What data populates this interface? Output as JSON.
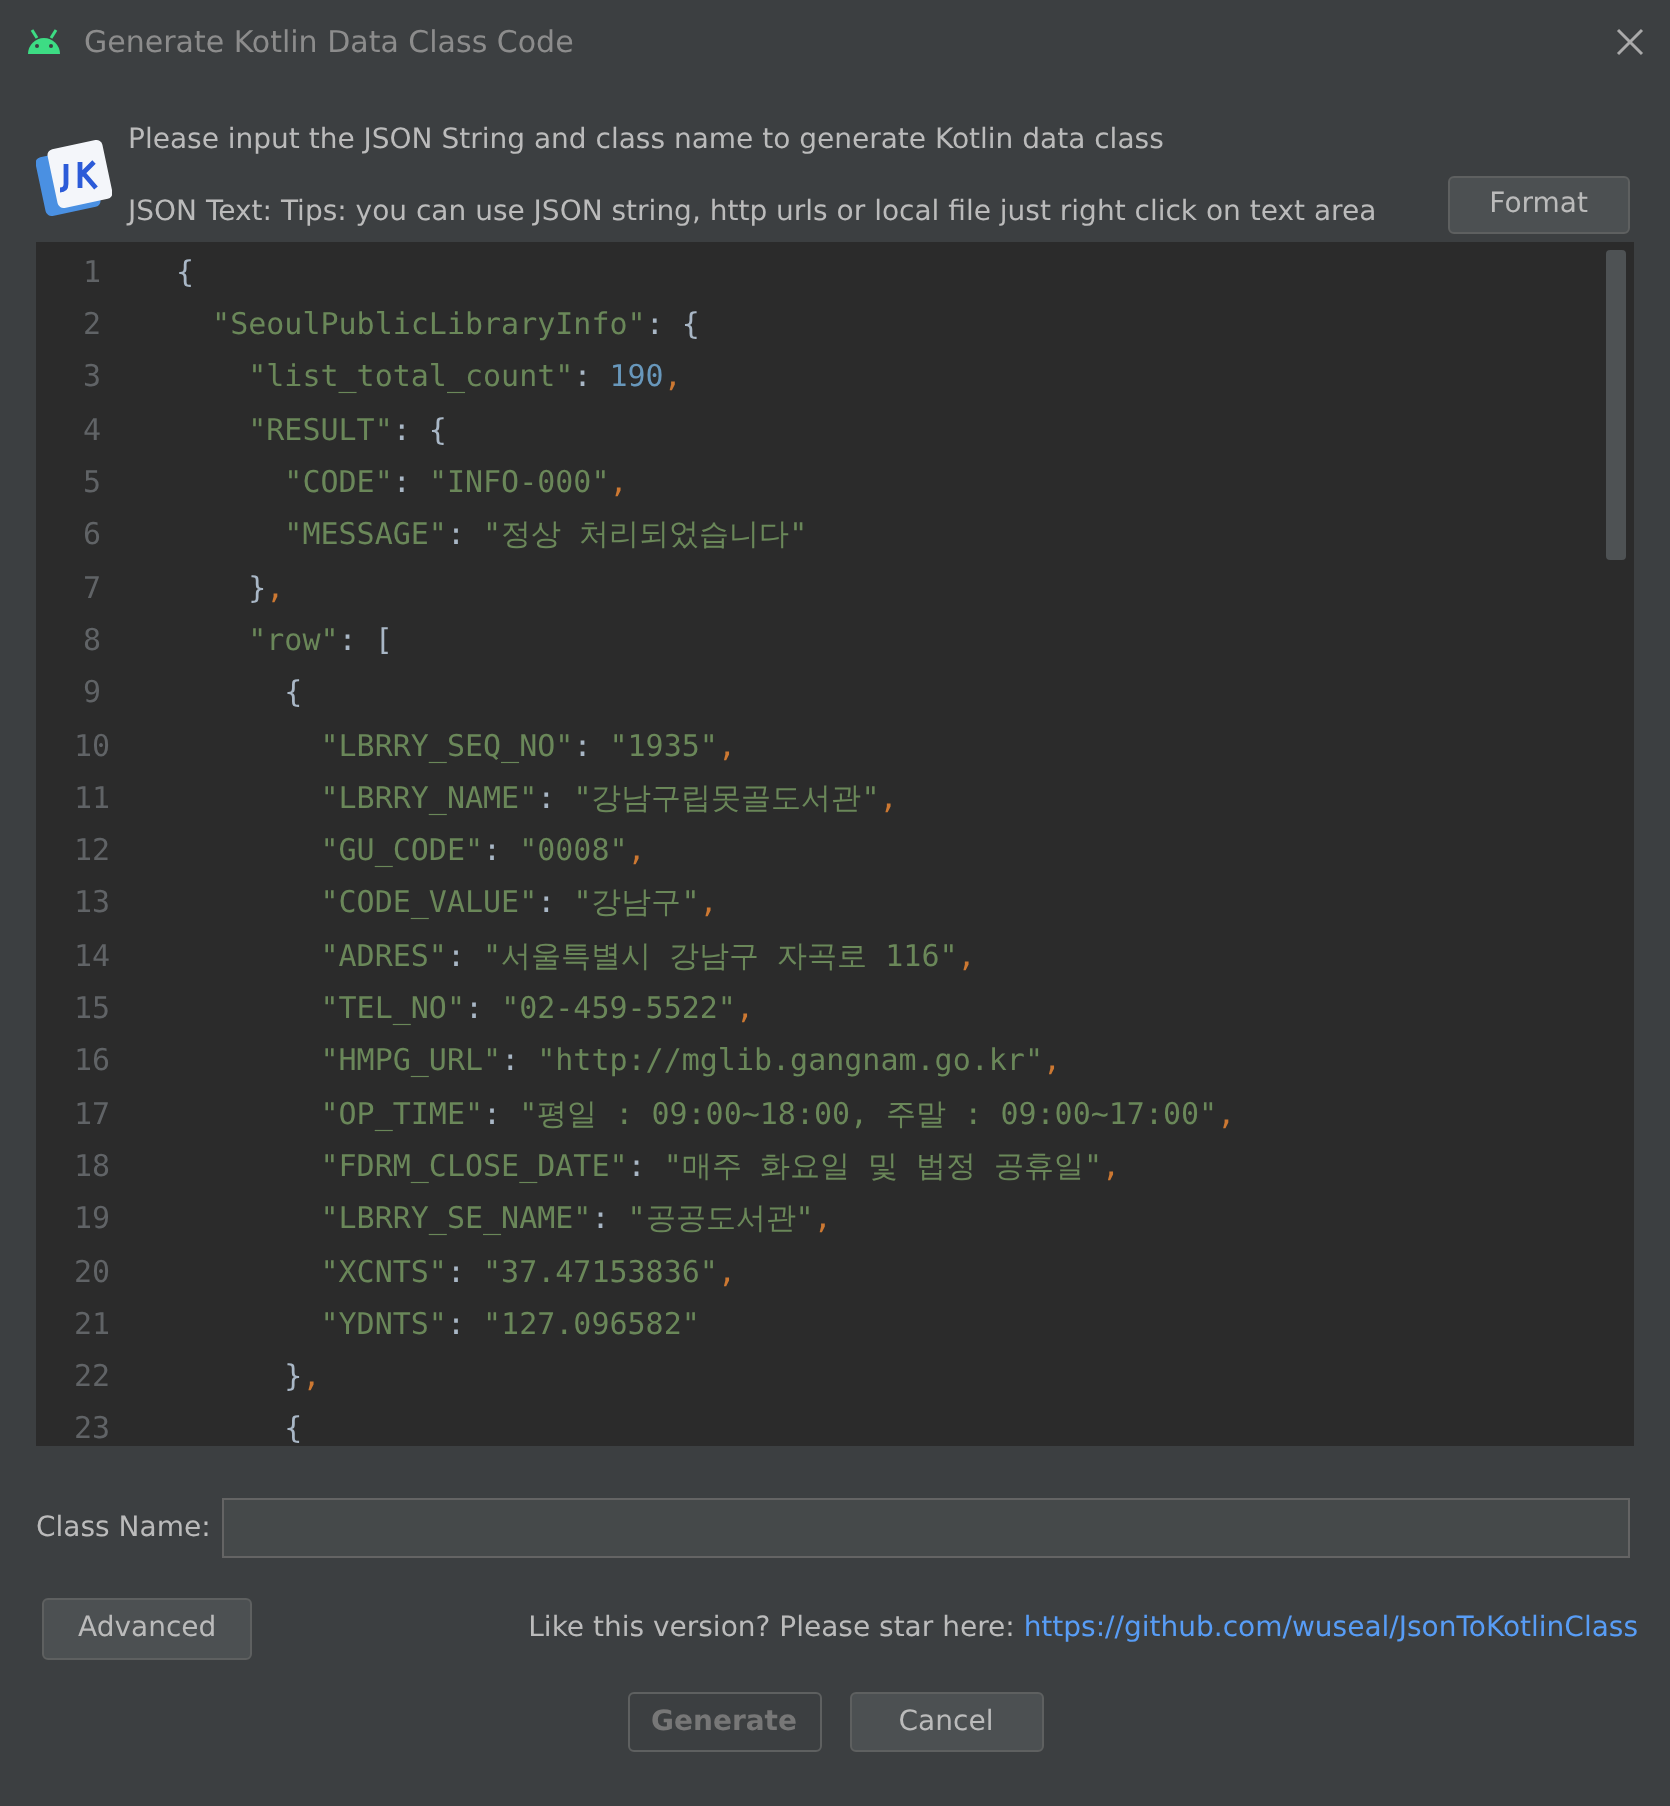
{
  "window": {
    "title": "Generate Kotlin Data Class Code"
  },
  "header": {
    "message": "Please input the JSON String and class name to generate Kotlin data class",
    "tips": "JSON Text: Tips: you can use JSON string, http urls or local file just right click on text area",
    "format_button": "Format"
  },
  "editor": {
    "lines": [
      {
        "number": "1",
        "tokens": [
          {
            "kind": "punct",
            "text": "{"
          }
        ]
      },
      {
        "number": "2",
        "tokens": [
          {
            "kind": "key",
            "text": "  \"SeoulPublicLibraryInfo\""
          },
          {
            "kind": "punct",
            "text": ": {"
          }
        ]
      },
      {
        "number": "3",
        "tokens": [
          {
            "kind": "key",
            "text": "    \"list_total_count\""
          },
          {
            "kind": "punct",
            "text": ": "
          },
          {
            "kind": "number",
            "text": "190"
          },
          {
            "kind": "comma",
            "text": ","
          }
        ]
      },
      {
        "number": "4",
        "tokens": [
          {
            "kind": "key",
            "text": "    \"RESULT\""
          },
          {
            "kind": "punct",
            "text": ": {"
          }
        ]
      },
      {
        "number": "5",
        "tokens": [
          {
            "kind": "key",
            "text": "      \"CODE\""
          },
          {
            "kind": "punct",
            "text": ": "
          },
          {
            "kind": "string",
            "text": "\"INFO-000\""
          },
          {
            "kind": "comma",
            "text": ","
          }
        ]
      },
      {
        "number": "6",
        "tokens": [
          {
            "kind": "key",
            "text": "      \"MESSAGE\""
          },
          {
            "kind": "punct",
            "text": ": "
          },
          {
            "kind": "string",
            "text": "\"정상 처리되었습니다\""
          }
        ]
      },
      {
        "number": "7",
        "tokens": [
          {
            "kind": "punct",
            "text": "    }"
          },
          {
            "kind": "comma",
            "text": ","
          }
        ]
      },
      {
        "number": "8",
        "tokens": [
          {
            "kind": "key",
            "text": "    \"row\""
          },
          {
            "kind": "punct",
            "text": ": ["
          }
        ]
      },
      {
        "number": "9",
        "tokens": [
          {
            "kind": "punct",
            "text": "      {"
          }
        ]
      },
      {
        "number": "10",
        "tokens": [
          {
            "kind": "key",
            "text": "        \"LBRRY_SEQ_NO\""
          },
          {
            "kind": "punct",
            "text": ": "
          },
          {
            "kind": "string",
            "text": "\"1935\""
          },
          {
            "kind": "comma",
            "text": ","
          }
        ]
      },
      {
        "number": "11",
        "tokens": [
          {
            "kind": "key",
            "text": "        \"LBRRY_NAME\""
          },
          {
            "kind": "punct",
            "text": ": "
          },
          {
            "kind": "string",
            "text": "\"강남구립못골도서관\""
          },
          {
            "kind": "comma",
            "text": ","
          }
        ]
      },
      {
        "number": "12",
        "tokens": [
          {
            "kind": "key",
            "text": "        \"GU_CODE\""
          },
          {
            "kind": "punct",
            "text": ": "
          },
          {
            "kind": "string",
            "text": "\"0008\""
          },
          {
            "kind": "comma",
            "text": ","
          }
        ]
      },
      {
        "number": "13",
        "tokens": [
          {
            "kind": "key",
            "text": "        \"CODE_VALUE\""
          },
          {
            "kind": "punct",
            "text": ": "
          },
          {
            "kind": "string",
            "text": "\"강남구\""
          },
          {
            "kind": "comma",
            "text": ","
          }
        ]
      },
      {
        "number": "14",
        "tokens": [
          {
            "kind": "key",
            "text": "        \"ADRES\""
          },
          {
            "kind": "punct",
            "text": ": "
          },
          {
            "kind": "string",
            "text": "\"서울특별시 강남구 자곡로 116\""
          },
          {
            "kind": "comma",
            "text": ","
          }
        ]
      },
      {
        "number": "15",
        "tokens": [
          {
            "kind": "key",
            "text": "        \"TEL_NO\""
          },
          {
            "kind": "punct",
            "text": ": "
          },
          {
            "kind": "string",
            "text": "\"02-459-5522\""
          },
          {
            "kind": "comma",
            "text": ","
          }
        ]
      },
      {
        "number": "16",
        "tokens": [
          {
            "kind": "key",
            "text": "        \"HMPG_URL\""
          },
          {
            "kind": "punct",
            "text": ": "
          },
          {
            "kind": "string",
            "text": "\"http://mglib.gangnam.go.kr\""
          },
          {
            "kind": "comma",
            "text": ","
          }
        ]
      },
      {
        "number": "17",
        "tokens": [
          {
            "kind": "key",
            "text": "        \"OP_TIME\""
          },
          {
            "kind": "punct",
            "text": ": "
          },
          {
            "kind": "string",
            "text": "\"평일 : 09:00~18:00, 주말 : 09:00~17:00\""
          },
          {
            "kind": "comma",
            "text": ","
          }
        ]
      },
      {
        "number": "18",
        "tokens": [
          {
            "kind": "key",
            "text": "        \"FDRM_CLOSE_DATE\""
          },
          {
            "kind": "punct",
            "text": ": "
          },
          {
            "kind": "string",
            "text": "\"매주 화요일 및 법정 공휴일\""
          },
          {
            "kind": "comma",
            "text": ","
          }
        ]
      },
      {
        "number": "19",
        "tokens": [
          {
            "kind": "key",
            "text": "        \"LBRRY_SE_NAME\""
          },
          {
            "kind": "punct",
            "text": ": "
          },
          {
            "kind": "string",
            "text": "\"공공도서관\""
          },
          {
            "kind": "comma",
            "text": ","
          }
        ]
      },
      {
        "number": "20",
        "tokens": [
          {
            "kind": "key",
            "text": "        \"XCNTS\""
          },
          {
            "kind": "punct",
            "text": ": "
          },
          {
            "kind": "string",
            "text": "\"37.47153836\""
          },
          {
            "kind": "comma",
            "text": ","
          }
        ]
      },
      {
        "number": "21",
        "tokens": [
          {
            "kind": "key",
            "text": "        \"YDNTS\""
          },
          {
            "kind": "punct",
            "text": ": "
          },
          {
            "kind": "string",
            "text": "\"127.096582\""
          }
        ]
      },
      {
        "number": "22",
        "tokens": [
          {
            "kind": "punct",
            "text": "      }"
          },
          {
            "kind": "comma",
            "text": ","
          }
        ]
      },
      {
        "number": "23",
        "tokens": [
          {
            "kind": "punct",
            "text": "      {"
          }
        ]
      }
    ]
  },
  "class_name": {
    "label": "Class Name:"
  },
  "advanced_button": "Advanced",
  "star_note": {
    "text": "Like this version? Please star here:",
    "link": "https://github.com/wuseal/JsonToKotlinClass"
  },
  "buttons": [
    {
      "label": "Generate",
      "disabled": true
    },
    {
      "label": "Cancel",
      "disabled": false
    }
  ]
}
